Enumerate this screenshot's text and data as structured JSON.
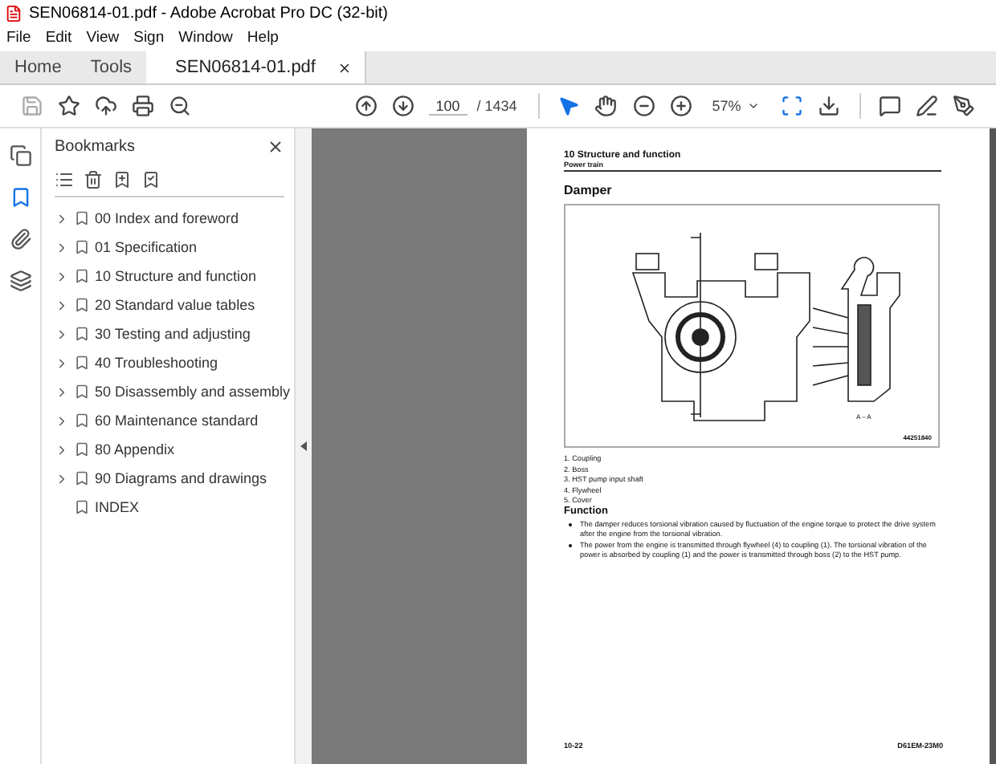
{
  "window": {
    "title": "SEN06814-01.pdf - Adobe Acrobat Pro DC (32-bit)"
  },
  "menu": [
    "File",
    "Edit",
    "View",
    "Sign",
    "Window",
    "Help"
  ],
  "tabs": [
    {
      "label": "Home",
      "selected": false,
      "kind": "nav"
    },
    {
      "label": "Tools",
      "selected": false,
      "kind": "nav"
    },
    {
      "label": "SEN06814-01.pdf",
      "selected": true,
      "kind": "document"
    }
  ],
  "toolbar": {
    "page": "100",
    "page_total": "/ 1434",
    "zoom": "57%"
  },
  "rail": [
    {
      "selected": false
    },
    {
      "selected": true
    },
    {
      "selected": false
    },
    {
      "selected": false
    }
  ],
  "bookmarks": {
    "title": "Bookmarks",
    "items": [
      {
        "label": "00 Index and foreword",
        "expandable": true
      },
      {
        "label": "01 Specification",
        "expandable": true
      },
      {
        "label": "10 Structure and function",
        "expandable": true
      },
      {
        "label": "20 Standard value tables",
        "expandable": true
      },
      {
        "label": "30 Testing and adjusting",
        "expandable": true
      },
      {
        "label": "40 Troubleshooting",
        "expandable": true
      },
      {
        "label": "50 Disassembly and assembly",
        "expandable": true
      },
      {
        "label": "60 Maintenance standard",
        "expandable": true
      },
      {
        "label": "80 Appendix",
        "expandable": true
      },
      {
        "label": "90 Diagrams and drawings",
        "expandable": true
      },
      {
        "label": "INDEX",
        "expandable": false
      }
    ]
  },
  "page": {
    "header": "10 Structure and function",
    "subheader": "Power train",
    "heading": "Damper",
    "figure": {
      "section_label": "A – A",
      "figure_id": "44251840"
    },
    "parts": [
      "1. Coupling",
      "2. Boss",
      "3. HST pump input shaft",
      "4. Flywheel",
      "5. Cover"
    ],
    "function_heading": "Function",
    "bullets": [
      "The damper reduces torsional vibration caused by fluctuation of the engine torque to protect the drive system after the engine from the torsional vibration.",
      "The power from the engine is transmitted through flywheel (4) to coupling (1). The torsional vibration of the power is absorbed by coupling (1) and the power is transmitted through boss (2) to the HST pump."
    ],
    "footer_left": "10-22",
    "footer_right": "D61EM-23M0"
  }
}
